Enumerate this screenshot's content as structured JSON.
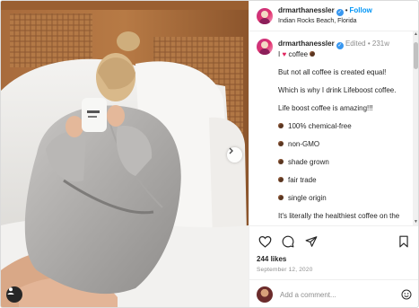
{
  "post": {
    "username": "drmarthanessler",
    "follow_label": "Follow",
    "location": "Indian Rocks Beach, Florida",
    "more_label": "···"
  },
  "caption": {
    "username": "drmarthanessler",
    "edited_label": "Edited",
    "age": "231w",
    "first_line_text": "coffee",
    "paragraphs": [
      "But not all coffee is created equal!",
      "Which is why I drink Lifeboost coffee.",
      "Life boost coffee is amazing!!!"
    ],
    "bullets": [
      "100% chemical-free",
      "non-GMO",
      "shade grown",
      "fair trade",
      "single origin"
    ],
    "closing": "It's literally the healthiest coffee on the"
  },
  "engagement": {
    "likes": "244 likes",
    "date": "September 12, 2020"
  },
  "comment_box": {
    "placeholder": "Add a comment..."
  },
  "icons": {
    "verified": "verified-badge-icon",
    "heart": "heart-icon",
    "comment": "comment-icon",
    "share": "share-icon",
    "save": "bookmark-icon",
    "emoji": "emoji-icon",
    "next": "chevron-right-icon",
    "tag": "user-tag-icon"
  },
  "colors": {
    "link_blue": "#0095f6",
    "verified_blue": "#3897f0",
    "text": "#262626",
    "muted": "#8e8e8e"
  }
}
